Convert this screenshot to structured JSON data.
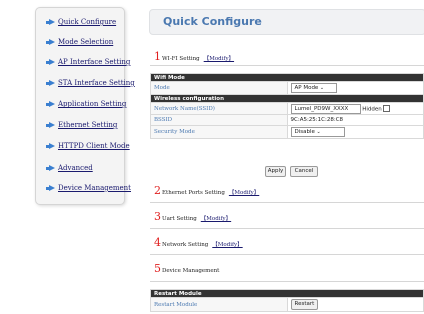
{
  "sidebar": {
    "items": [
      {
        "label": "Quick Configure"
      },
      {
        "label": "Mode Selection"
      },
      {
        "label": "AP Interface Setting"
      },
      {
        "label": "STA Interface Setting"
      },
      {
        "label": "Application Setting"
      },
      {
        "label": "Ethernet Setting"
      },
      {
        "label": "HTTPD Client Mode"
      },
      {
        "label": "Advanced"
      },
      {
        "label": "Device Management"
      }
    ]
  },
  "header": {
    "title": "Quick Configure"
  },
  "sections": [
    {
      "number": "1",
      "title": "WI-FI Setting",
      "modify": "【Modify】"
    },
    {
      "number": "2",
      "title": "Ethernet Ports Setting",
      "modify": "【Modify】"
    },
    {
      "number": "3",
      "title": "Uart Setting",
      "modify": "【Modify】"
    },
    {
      "number": "4",
      "title": "Network Setting",
      "modify": "【Modify】"
    },
    {
      "number": "5",
      "title": "Device Management",
      "modify": ""
    }
  ],
  "wifi": {
    "wifi_mode_header": "Wifi Mode",
    "mode_label": "Mode",
    "mode_value": "AP Mode",
    "wireless_header": "Wireless configuration",
    "ssid_label": "Network Name(SSID)",
    "ssid_value": "Lumel_PD9W_XXXX",
    "hidden_label": "Hidden",
    "bssid_label": "BSSID",
    "bssid_value": "9C:A5:25:1C:28:C8",
    "security_label": "Security Mode",
    "security_value": "Disable",
    "apply_label": "Apply",
    "cancel_label": "Cancel"
  },
  "device": {
    "restart_header": "Restart Module",
    "restart_label": "Restart Module",
    "restart_button": "Restart"
  },
  "colors": {
    "accent": "#4a78b0",
    "section_number": "#e02020",
    "table_header": "#333333",
    "link": "#1a1a6e"
  }
}
